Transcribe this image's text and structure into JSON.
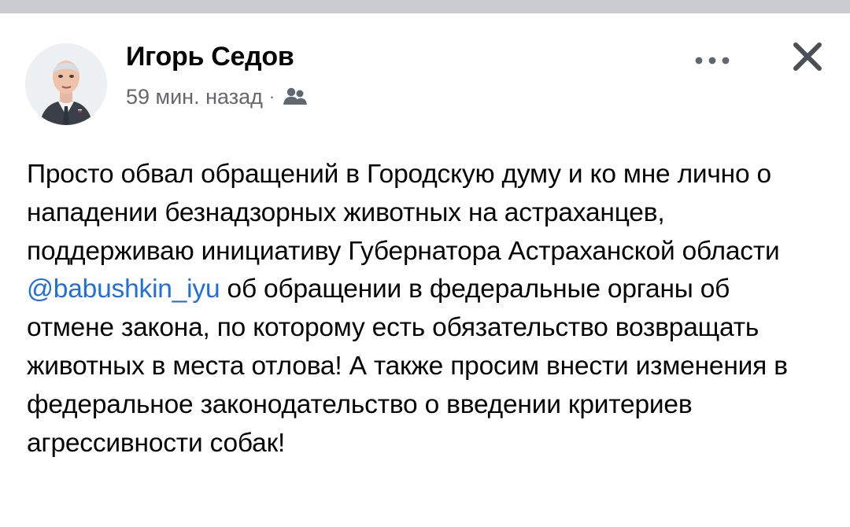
{
  "post": {
    "author": "Игорь Седов",
    "time": "59 мин. назад",
    "separator": "·",
    "audience_icon": "friends-icon",
    "more_icon": "more-horizontal-icon",
    "close_icon": "close-icon",
    "avatar": "author-avatar",
    "text_part1": "Просто обвал обращений в Городскую думу и ко мне лично о нападении безнадзорных животных на астраханцев, поддерживаю инициативу Губернатора Астраханской области ",
    "mention": "@babushkin_iyu",
    "text_part2": " об обращении в федеральные органы об отмене закона, по которому есть обязательство возвращать животных в места отлова! А также просим внести изменения в федеральное законодательство о введении критериев агрессивности собак!"
  },
  "colors": {
    "top_strip": "#c9ccd1",
    "text": "#050505",
    "meta": "#65676b",
    "mention": "#216fdb",
    "icon": "#606770"
  }
}
